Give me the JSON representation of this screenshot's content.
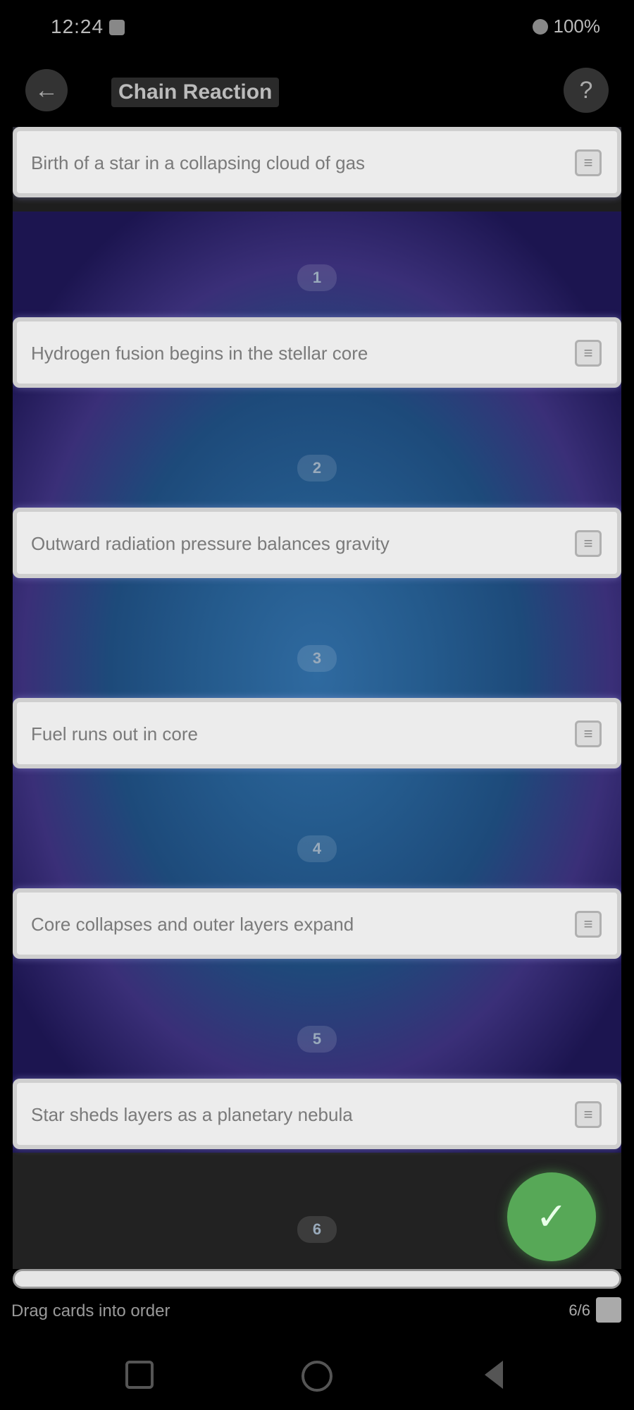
{
  "status_bar": {
    "time": "12:24",
    "battery": "100%"
  },
  "top_bar": {
    "back_icon": "arrow-left-icon",
    "title": "Chain Reaction",
    "help_icon": "question-icon"
  },
  "board": {
    "cards": [
      {
        "text": "Birth of a star in a collapsing cloud of gas",
        "icon": "drag-handle-icon"
      },
      {
        "text": "Hydrogen fusion begins in the stellar core",
        "icon": "drag-handle-icon"
      },
      {
        "text": "Outward radiation pressure balances gravity",
        "icon": "drag-handle-icon"
      },
      {
        "text": "Fuel runs out in core",
        "icon": "drag-handle-icon"
      },
      {
        "text": "Core collapses and outer layers expand",
        "icon": "drag-handle-icon"
      },
      {
        "text": "Star sheds layers as a planetary nebula",
        "icon": "drag-handle-icon"
      }
    ],
    "stage_labels": [
      "1",
      "2",
      "3",
      "4",
      "5",
      "6"
    ]
  },
  "fab": {
    "icon": "check-icon"
  },
  "progress": {
    "fraction": 1.0
  },
  "footer": {
    "left_text": "Drag cards into order",
    "right_text": "6/6"
  },
  "colors": {
    "accent_green": "#57a857",
    "board_center": "#2f6aa0",
    "board_edge": "#1c1550"
  }
}
